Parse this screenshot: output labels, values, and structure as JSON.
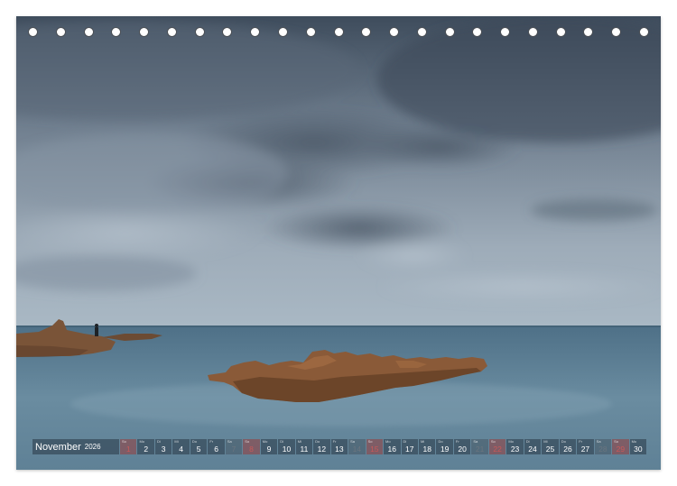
{
  "calendar": {
    "month": "November",
    "year": "2026",
    "days": [
      {
        "day": "1",
        "weekday": "So",
        "type": "sunday"
      },
      {
        "day": "2",
        "weekday": "Mo",
        "type": "weekday"
      },
      {
        "day": "3",
        "weekday": "Di",
        "type": "weekday"
      },
      {
        "day": "4",
        "weekday": "Mi",
        "type": "weekday"
      },
      {
        "day": "5",
        "weekday": "Do",
        "type": "weekday"
      },
      {
        "day": "6",
        "weekday": "Fr",
        "type": "weekday"
      },
      {
        "day": "7",
        "weekday": "Sa",
        "type": "saturday"
      },
      {
        "day": "8",
        "weekday": "So",
        "type": "sunday"
      },
      {
        "day": "9",
        "weekday": "Mo",
        "type": "weekday"
      },
      {
        "day": "10",
        "weekday": "Di",
        "type": "weekday"
      },
      {
        "day": "11",
        "weekday": "Mi",
        "type": "weekday"
      },
      {
        "day": "12",
        "weekday": "Do",
        "type": "weekday"
      },
      {
        "day": "13",
        "weekday": "Fr",
        "type": "weekday"
      },
      {
        "day": "14",
        "weekday": "Sa",
        "type": "saturday"
      },
      {
        "day": "15",
        "weekday": "So",
        "type": "sunday"
      },
      {
        "day": "16",
        "weekday": "Mo",
        "type": "weekday"
      },
      {
        "day": "17",
        "weekday": "Di",
        "type": "weekday"
      },
      {
        "day": "18",
        "weekday": "Mi",
        "type": "weekday"
      },
      {
        "day": "19",
        "weekday": "Do",
        "type": "weekday"
      },
      {
        "day": "20",
        "weekday": "Fr",
        "type": "weekday"
      },
      {
        "day": "21",
        "weekday": "Sa",
        "type": "saturday"
      },
      {
        "day": "22",
        "weekday": "So",
        "type": "sunday"
      },
      {
        "day": "23",
        "weekday": "Mo",
        "type": "weekday"
      },
      {
        "day": "24",
        "weekday": "Di",
        "type": "weekday"
      },
      {
        "day": "25",
        "weekday": "Mi",
        "type": "weekday"
      },
      {
        "day": "26",
        "weekday": "Do",
        "type": "weekday"
      },
      {
        "day": "27",
        "weekday": "Fr",
        "type": "weekday"
      },
      {
        "day": "28",
        "weekday": "Sa",
        "type": "saturday"
      },
      {
        "day": "29",
        "weekday": "So",
        "type": "sunday"
      },
      {
        "day": "30",
        "weekday": "Mo",
        "type": "weekday"
      }
    ]
  },
  "binding": {
    "hole_count": 23
  },
  "colors": {
    "sky_top": "#3e4c5c",
    "sky_mid": "#8594a3",
    "sky_horizon": "#a9b8c4",
    "sea": "#5f8196",
    "rock": "#8a5a38",
    "sunday": "#c75a5a"
  }
}
